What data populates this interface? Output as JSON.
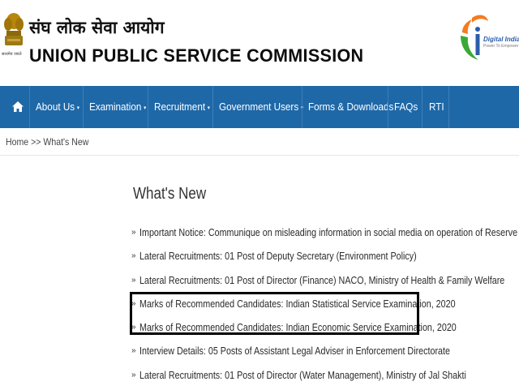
{
  "header": {
    "title_hindi": "संघ लोक सेवा आयोग",
    "title_english": "UNION PUBLIC SERVICE COMMISSION",
    "emblem_caption": "सत्यमेव जयते",
    "digital_india_title": "Digital India",
    "digital_india_tagline": "Power To Empower"
  },
  "nav": {
    "items": [
      {
        "label": "About Us",
        "dropdown": true
      },
      {
        "label": "Examination",
        "dropdown": true
      },
      {
        "label": "Recruitment",
        "dropdown": true
      },
      {
        "label": "Government Users",
        "dropdown": true
      },
      {
        "label": "Forms & Downloads",
        "dropdown": false
      },
      {
        "label": "FAQs",
        "dropdown": false
      },
      {
        "label": "RTI",
        "dropdown": false
      }
    ],
    "caret": "▾"
  },
  "breadcrumb": "Home >> What's New",
  "page_title": "What's New",
  "bullet": "»",
  "news": [
    "Important Notice: Communique on misleading information in social media on operation of Reserve List",
    "Lateral Recruitments: 01 Post of Deputy Secretary (Environment Policy)",
    "Lateral Recruitments: 01 Post of Director (Finance) NACO, Ministry of Health & Family Welfare",
    "Marks of Recommended Candidates: Indian Statistical Service Examination, 2020",
    "Marks of Recommended Candidates: Indian Economic Service Examination, 2020",
    "Interview Details: 05 Posts of Assistant Legal Adviser in Enforcement Directorate",
    "Lateral Recruitments: 01 Post of Director (Water Management), Ministry of Jal Shakti"
  ],
  "colors": {
    "nav_bg": "#1e68a8",
    "highlight_border": "#000000",
    "digital_india_blue": "#2b5daa",
    "digital_india_orange": "#f47b20",
    "digital_india_green": "#3aa935"
  }
}
